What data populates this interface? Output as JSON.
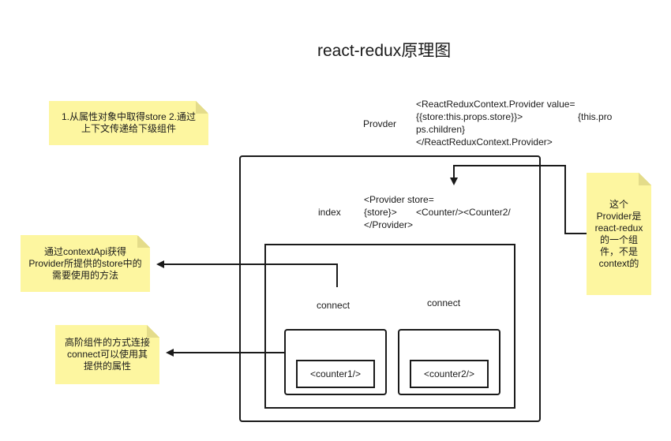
{
  "title": "react-redux原理图",
  "notes": {
    "store_note": "1.从属性对象中取得store 2.通过上下文传递给下级组件",
    "context_api_note": "通过contextApi获得Provider所提供的store中的需要使用的方法",
    "hoc_note": "高阶组件的方式连接connect可以使用其提供的属性",
    "provider_note": "这个Provider是react-redux的一个组件，不是context的"
  },
  "provider": {
    "label": "Provder",
    "code_line1": "<ReactReduxContext.Provider value=",
    "code_line2": "{{store:this.props.store}}>",
    "code_line2b": "{this.pro",
    "code_line3": "ps.children}",
    "code_line4": "</ReactReduxContext.Provider>"
  },
  "index": {
    "label": "index",
    "code_line1": "<Provider store=",
    "code_line2": "{store}>",
    "code_line2b": "<Counter/><Counter2/",
    "code_line3": "</Provider>"
  },
  "connect_left": "connect",
  "connect_right": "connect",
  "counter1": "<counter1/>",
  "counter2": "<counter2/>",
  "colors": {
    "note_bg": "#fdf6a0",
    "line": "#1a1a1a"
  }
}
